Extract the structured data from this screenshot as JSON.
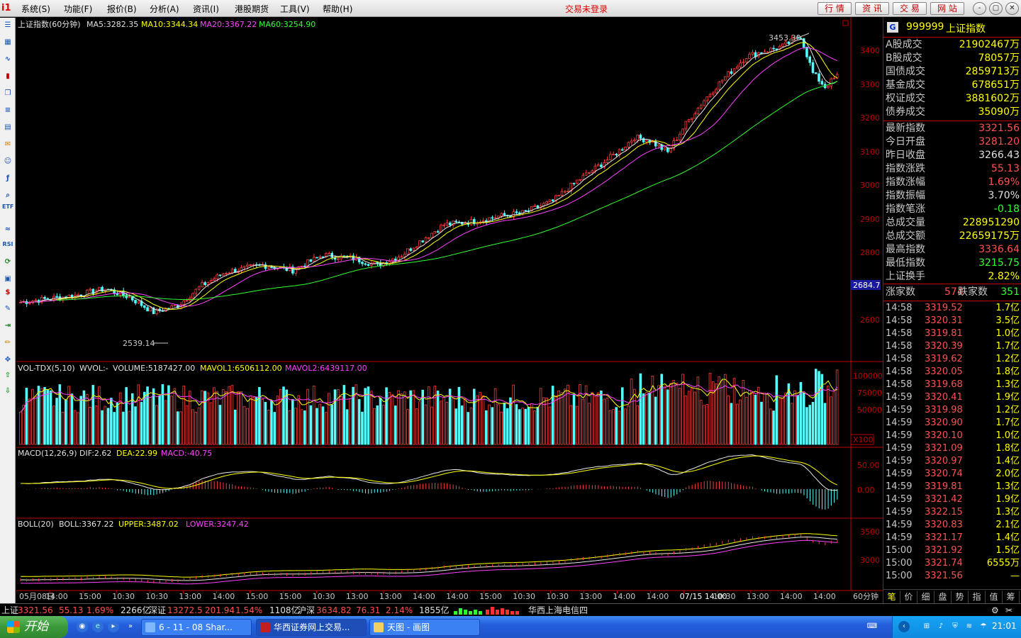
{
  "menu": [
    "系统(S)",
    "功能(F)",
    "报价(B)",
    "分析(A)",
    "资讯(I)",
    "港股期货",
    "工具(V)",
    "帮助(H)"
  ],
  "login_status": "交易未登录",
  "top_buttons": [
    "行 情",
    "资 讯",
    "交 易",
    "网 站"
  ],
  "window_buttons": [
    "-",
    "▢",
    "✕"
  ],
  "main_chart": {
    "title": "上证指数(60分钟)",
    "ma5": "MA5:3282.35",
    "ma10": "MA10:3344.34",
    "ma20": "MA20:3367.22",
    "ma60": "MA60:3254.90",
    "high_annotation": "3453.30",
    "low_annotation": "2539.14",
    "current_mark": "2684.7",
    "y_axis": [
      "3400",
      "3300",
      "3200",
      "3100",
      "3000",
      "2900",
      "2800",
      "2700",
      "2600"
    ]
  },
  "vol_panel": {
    "label": "VOL-TDX(5,10)",
    "wvol": "WVOL:-",
    "volume": "VOLUME:5187427.00",
    "mavol1": "MAVOL1:6506112.00",
    "mavol2": "MAVOL2:6439117.00",
    "y_axis": [
      "100000",
      "75000",
      "50000"
    ],
    "unit": "X100"
  },
  "macd_panel": {
    "label": "MACD(12,26,9)",
    "dif": "DIF:2.62",
    "dea": "DEA:22.99",
    "macd": "MACD:-40.75",
    "y_axis": [
      "50.00",
      "0.00"
    ]
  },
  "boll_panel": {
    "label": "BOLL(20)",
    "boll": "BOLL:3367.22",
    "upper": "UPPER:3487.02",
    "lower": "LOWER:3247.42",
    "y_axis": [
      "3500",
      "3000"
    ]
  },
  "x_axis": [
    "05月08日",
    "14:00",
    "15:00",
    "10:30",
    "10:30",
    "13:00",
    "14:00",
    "15:00",
    "15:00",
    "10:30",
    "13:00",
    "13:00",
    "14:00",
    "14:00",
    "15:00",
    "10:30",
    "10:30",
    "13:00",
    "14:00",
    "14:00",
    "07/15 14:00",
    "10:30",
    "13:00",
    "14:00",
    "14:00"
  ],
  "period_label": "60分钟",
  "stock": {
    "code": "999999",
    "name": "上证指数"
  },
  "market_rows": [
    {
      "k": "A股成交",
      "v": "21902467万"
    },
    {
      "k": "B股成交",
      "v": "78057万"
    },
    {
      "k": "国债成交",
      "v": "2859713万"
    },
    {
      "k": "基金成交",
      "v": "678651万"
    },
    {
      "k": "权证成交",
      "v": "3881602万"
    },
    {
      "k": "债券成交",
      "v": "35090万"
    }
  ],
  "index_rows": [
    {
      "k": "最新指数",
      "v": "3321.56",
      "c": "#ff5050"
    },
    {
      "k": "今日开盘",
      "v": "3281.20",
      "c": "#ff5050"
    },
    {
      "k": "昨日收盘",
      "v": "3266.43",
      "c": "#e0e0e0"
    },
    {
      "k": "指数涨跌",
      "v": "55.13",
      "c": "#ff5050"
    },
    {
      "k": "指数涨幅",
      "v": "1.69%",
      "c": "#ff5050"
    },
    {
      "k": "指数振幅",
      "v": "3.70%",
      "c": "#e0e0e0"
    },
    {
      "k": "指数笔涨",
      "v": "-0.18",
      "c": "#30ff30"
    },
    {
      "k": "总成交量",
      "v": "228951290",
      "c": "#ffff00"
    },
    {
      "k": "总成交额",
      "v": "22659175万",
      "c": "#ffff00"
    },
    {
      "k": "最高指数",
      "v": "3336.64",
      "c": "#ff5050"
    },
    {
      "k": "最低指数",
      "v": "3215.75",
      "c": "#30ff30"
    },
    {
      "k": "上证换手",
      "v": "2.82%",
      "c": "#ffff00"
    }
  ],
  "updown": {
    "up_label": "涨家数",
    "up": "574",
    "down_label": "跌家数",
    "down": "351"
  },
  "ticks": [
    {
      "t": "14:58",
      "p": "3319.52",
      "q": "1.7亿"
    },
    {
      "t": "14:58",
      "p": "3320.31",
      "q": "3.5亿"
    },
    {
      "t": "14:58",
      "p": "3319.81",
      "q": "1.0亿"
    },
    {
      "t": "14:58",
      "p": "3320.39",
      "q": "1.7亿"
    },
    {
      "t": "14:58",
      "p": "3319.62",
      "q": "1.2亿"
    },
    {
      "t": "14:58",
      "p": "3320.05",
      "q": "1.8亿"
    },
    {
      "t": "14:58",
      "p": "3319.68",
      "q": "1.3亿"
    },
    {
      "t": "14:59",
      "p": "3320.41",
      "q": "1.9亿"
    },
    {
      "t": "14:59",
      "p": "3319.98",
      "q": "1.2亿"
    },
    {
      "t": "14:59",
      "p": "3320.90",
      "q": "1.7亿"
    },
    {
      "t": "14:59",
      "p": "3320.10",
      "q": "1.0亿"
    },
    {
      "t": "14:59",
      "p": "3321.09",
      "q": "1.8亿"
    },
    {
      "t": "14:59",
      "p": "3320.97",
      "q": "1.4亿"
    },
    {
      "t": "14:59",
      "p": "3320.74",
      "q": "2.0亿"
    },
    {
      "t": "14:59",
      "p": "3319.81",
      "q": "1.3亿"
    },
    {
      "t": "14:59",
      "p": "3321.42",
      "q": "1.9亿"
    },
    {
      "t": "14:59",
      "p": "3322.15",
      "q": "1.3亿"
    },
    {
      "t": "14:59",
      "p": "3320.83",
      "q": "2.1亿"
    },
    {
      "t": "14:59",
      "p": "3321.17",
      "q": "1.4亿"
    },
    {
      "t": "15:00",
      "p": "3321.92",
      "q": "1.5亿"
    },
    {
      "t": "15:00",
      "p": "3321.74",
      "q": "6555万"
    },
    {
      "t": "15:00",
      "p": "3321.56",
      "q": "—"
    }
  ],
  "right_tabs": [
    "笔",
    "价",
    "细",
    "盘",
    "势",
    "指",
    "值",
    "筹"
  ],
  "statusbar": {
    "sh_label": "上证",
    "sh_val": "3321.56",
    "sh_chg": "55.13",
    "sh_pct": "1.69%",
    "sh_amt": "2266亿",
    "sz_label": "深证",
    "sz_val": "13272.5",
    "sz_chg": "201.94",
    "sz_pct": "1.54%",
    "sz_amt": "1108亿",
    "hs_label": "沪深",
    "hs_val": "3634.82",
    "hs_chg": "76.31",
    "hs_pct": "2.14%",
    "hs_amt": "1855亿",
    "server": "华西上海电信四"
  },
  "taskbar": {
    "start": "开始",
    "tasks": [
      "6 - 11 - 08 Shar...",
      "华西证券网上交易...",
      "天图 - 画图"
    ],
    "clock": "21:01"
  }
}
